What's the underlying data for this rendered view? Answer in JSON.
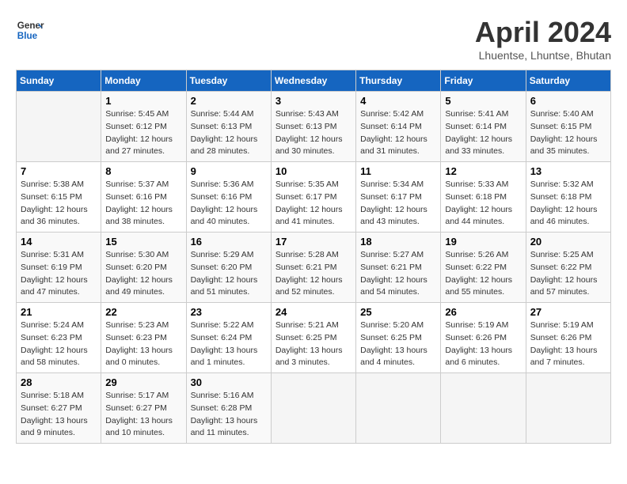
{
  "header": {
    "logo_line1": "General",
    "logo_line2": "Blue",
    "month_title": "April 2024",
    "subtitle": "Lhuentse, Lhuntse, Bhutan"
  },
  "weekdays": [
    "Sunday",
    "Monday",
    "Tuesday",
    "Wednesday",
    "Thursday",
    "Friday",
    "Saturday"
  ],
  "weeks": [
    [
      {
        "num": "",
        "info": ""
      },
      {
        "num": "1",
        "info": "Sunrise: 5:45 AM\nSunset: 6:12 PM\nDaylight: 12 hours\nand 27 minutes."
      },
      {
        "num": "2",
        "info": "Sunrise: 5:44 AM\nSunset: 6:13 PM\nDaylight: 12 hours\nand 28 minutes."
      },
      {
        "num": "3",
        "info": "Sunrise: 5:43 AM\nSunset: 6:13 PM\nDaylight: 12 hours\nand 30 minutes."
      },
      {
        "num": "4",
        "info": "Sunrise: 5:42 AM\nSunset: 6:14 PM\nDaylight: 12 hours\nand 31 minutes."
      },
      {
        "num": "5",
        "info": "Sunrise: 5:41 AM\nSunset: 6:14 PM\nDaylight: 12 hours\nand 33 minutes."
      },
      {
        "num": "6",
        "info": "Sunrise: 5:40 AM\nSunset: 6:15 PM\nDaylight: 12 hours\nand 35 minutes."
      }
    ],
    [
      {
        "num": "7",
        "info": "Sunrise: 5:38 AM\nSunset: 6:15 PM\nDaylight: 12 hours\nand 36 minutes."
      },
      {
        "num": "8",
        "info": "Sunrise: 5:37 AM\nSunset: 6:16 PM\nDaylight: 12 hours\nand 38 minutes."
      },
      {
        "num": "9",
        "info": "Sunrise: 5:36 AM\nSunset: 6:16 PM\nDaylight: 12 hours\nand 40 minutes."
      },
      {
        "num": "10",
        "info": "Sunrise: 5:35 AM\nSunset: 6:17 PM\nDaylight: 12 hours\nand 41 minutes."
      },
      {
        "num": "11",
        "info": "Sunrise: 5:34 AM\nSunset: 6:17 PM\nDaylight: 12 hours\nand 43 minutes."
      },
      {
        "num": "12",
        "info": "Sunrise: 5:33 AM\nSunset: 6:18 PM\nDaylight: 12 hours\nand 44 minutes."
      },
      {
        "num": "13",
        "info": "Sunrise: 5:32 AM\nSunset: 6:18 PM\nDaylight: 12 hours\nand 46 minutes."
      }
    ],
    [
      {
        "num": "14",
        "info": "Sunrise: 5:31 AM\nSunset: 6:19 PM\nDaylight: 12 hours\nand 47 minutes."
      },
      {
        "num": "15",
        "info": "Sunrise: 5:30 AM\nSunset: 6:20 PM\nDaylight: 12 hours\nand 49 minutes."
      },
      {
        "num": "16",
        "info": "Sunrise: 5:29 AM\nSunset: 6:20 PM\nDaylight: 12 hours\nand 51 minutes."
      },
      {
        "num": "17",
        "info": "Sunrise: 5:28 AM\nSunset: 6:21 PM\nDaylight: 12 hours\nand 52 minutes."
      },
      {
        "num": "18",
        "info": "Sunrise: 5:27 AM\nSunset: 6:21 PM\nDaylight: 12 hours\nand 54 minutes."
      },
      {
        "num": "19",
        "info": "Sunrise: 5:26 AM\nSunset: 6:22 PM\nDaylight: 12 hours\nand 55 minutes."
      },
      {
        "num": "20",
        "info": "Sunrise: 5:25 AM\nSunset: 6:22 PM\nDaylight: 12 hours\nand 57 minutes."
      }
    ],
    [
      {
        "num": "21",
        "info": "Sunrise: 5:24 AM\nSunset: 6:23 PM\nDaylight: 12 hours\nand 58 minutes."
      },
      {
        "num": "22",
        "info": "Sunrise: 5:23 AM\nSunset: 6:23 PM\nDaylight: 13 hours\nand 0 minutes."
      },
      {
        "num": "23",
        "info": "Sunrise: 5:22 AM\nSunset: 6:24 PM\nDaylight: 13 hours\nand 1 minutes."
      },
      {
        "num": "24",
        "info": "Sunrise: 5:21 AM\nSunset: 6:25 PM\nDaylight: 13 hours\nand 3 minutes."
      },
      {
        "num": "25",
        "info": "Sunrise: 5:20 AM\nSunset: 6:25 PM\nDaylight: 13 hours\nand 4 minutes."
      },
      {
        "num": "26",
        "info": "Sunrise: 5:19 AM\nSunset: 6:26 PM\nDaylight: 13 hours\nand 6 minutes."
      },
      {
        "num": "27",
        "info": "Sunrise: 5:19 AM\nSunset: 6:26 PM\nDaylight: 13 hours\nand 7 minutes."
      }
    ],
    [
      {
        "num": "28",
        "info": "Sunrise: 5:18 AM\nSunset: 6:27 PM\nDaylight: 13 hours\nand 9 minutes."
      },
      {
        "num": "29",
        "info": "Sunrise: 5:17 AM\nSunset: 6:27 PM\nDaylight: 13 hours\nand 10 minutes."
      },
      {
        "num": "30",
        "info": "Sunrise: 5:16 AM\nSunset: 6:28 PM\nDaylight: 13 hours\nand 11 minutes."
      },
      {
        "num": "",
        "info": ""
      },
      {
        "num": "",
        "info": ""
      },
      {
        "num": "",
        "info": ""
      },
      {
        "num": "",
        "info": ""
      }
    ]
  ]
}
